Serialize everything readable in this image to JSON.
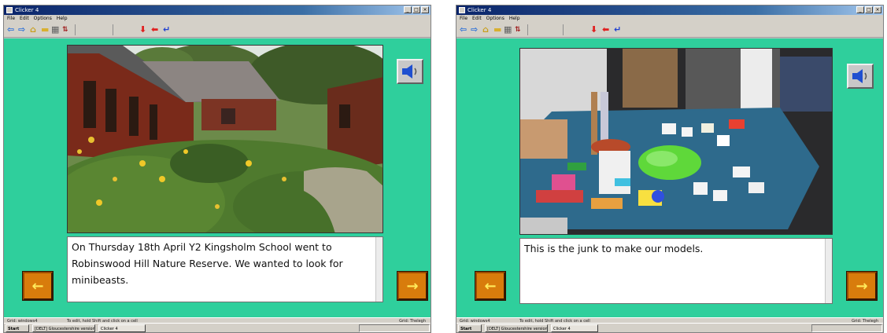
{
  "windows": [
    {
      "title": "Clicker 4",
      "window_buttons": [
        "_",
        "□",
        "×"
      ],
      "menu": [
        "File",
        "Edit",
        "Options",
        "Help"
      ],
      "photo_subject": "school building with garden",
      "caption": "On Thursday 18th April Y2 Kingsholm School went to Robinswood Hill Nature Reserve. We wanted to look for minibeasts.",
      "nav": {
        "prev_symbol": "←",
        "next_symbol": "→"
      },
      "status": {
        "left": "Grid: windows4",
        "middle": "To edit, hold Shift and click on a cell",
        "right": "Grid: Thelegh"
      },
      "taskbar": {
        "start": "Start",
        "tasks": [
          "[DELT] Gloucestershire version...",
          "Clicker 4"
        ]
      }
    },
    {
      "title": "Clicker 4",
      "window_buttons": [
        "_",
        "□",
        "×"
      ],
      "menu": [
        "File",
        "Edit",
        "Options",
        "Help"
      ],
      "photo_subject": "table of junk modelling materials",
      "caption": "This is the junk to make our models.",
      "nav": {
        "prev_symbol": "←",
        "next_symbol": "→"
      },
      "status": {
        "left": "Grid: windows4",
        "middle": "To edit, hold Shift and click on a cell",
        "right": "Grid: Thelegh"
      },
      "taskbar": {
        "start": "Start",
        "tasks": [
          "[DELT] Gloucestershire version...",
          "Clicker 4"
        ]
      }
    }
  ],
  "colors": {
    "stage": "#2fcf9c",
    "nav_button": "#d87c0c",
    "nav_arrow": "#ffea5a",
    "titlebar": "#0a246a"
  },
  "icons": [
    "back-icon",
    "forward-icon",
    "home-icon",
    "folder-icon",
    "grid-icon",
    "sort-icon",
    "speaker-icon",
    "arrow-left-icon",
    "arrow-right-icon"
  ]
}
